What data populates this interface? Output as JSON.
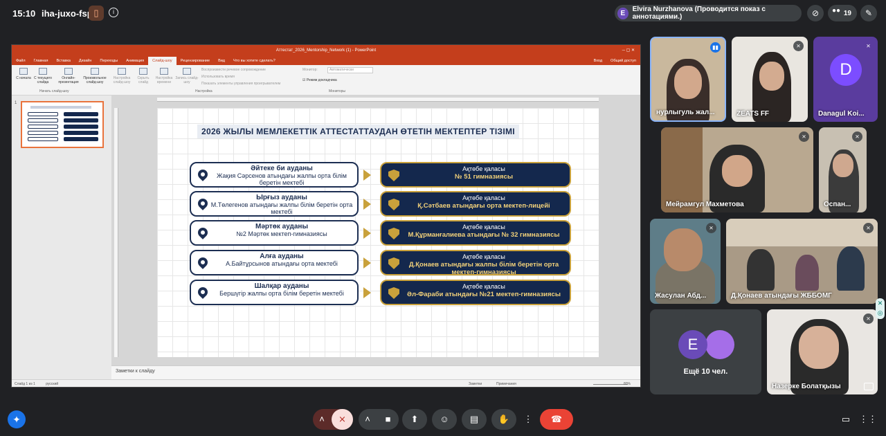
{
  "topbar": {
    "time": "15:10",
    "meeting_code": "iha-juxo-fsp",
    "presenter_initial": "E",
    "presenter_text": "Elvira Nurzhanova (Проводится показ с аннотациями.)",
    "participants_count": "19"
  },
  "ppt": {
    "window_title": "Аттестат_2026_Mentorship_Network (1) - PowerPoint",
    "tabs": [
      "Файл",
      "Главная",
      "Вставка",
      "Дизайн",
      "Переходы",
      "Анимация",
      "Слайд-шоу",
      "Рецензирование",
      "Вид",
      "Что вы хотите сделать?"
    ],
    "active_tab": "Слайд-шоу",
    "login": "Вход",
    "share": "Общий доступ",
    "ribbon": {
      "btn1": "С начала",
      "btn2": "С текущего слайда",
      "btn3": "Онлайн-презентация",
      "btn4": "Произвольное слайд-шоу",
      "group1": "Начать слайд-шоу",
      "btn5": "Настройка слайд-шоу",
      "btn6": "Скрыть слайд",
      "btn7": "Настройка времени",
      "btn8": "Запись слайд-шоу",
      "opt1": "Воспроизвести речевое сопровождение",
      "opt2": "Использовать время",
      "opt3": "Показать элементы управления проигрывателем",
      "group2": "Настройка",
      "monitor_label": "Монитор:",
      "monitor_value": "Автоматически",
      "presenter_mode": "Режим докладчика",
      "group3": "Мониторы"
    },
    "thumb_number": "1",
    "notes_placeholder": "Заметки к слайду",
    "status_left": "Слайд 1 из 1",
    "status_lang": "русский",
    "status_notes": "Заметки",
    "status_comments": "Примечания",
    "zoom": "80%"
  },
  "slide": {
    "title": "2026 ЖЫЛЫ МЕМЛЕКЕТТІК АТТЕСТАТТАУДАН ӨТЕТІН МЕКТЕПТЕР ТІЗІМІ",
    "rows": [
      {
        "district": "Әйтеке би ауданы",
        "school": "Жақия Сәрсенов атындағы жалпы орта білім беретін мектебі",
        "city": "Ақтөбе қаласы",
        "gymnasium": "№ 51 гимназиясы"
      },
      {
        "district": "Ырғыз ауданы",
        "school": "М.Төлегенов атындағы жалпы білім беретін орта мектебі",
        "city": "Ақтөбе қаласы",
        "gymnasium": "Қ.Сәтбаев атындағы орта мектеп-лицейі"
      },
      {
        "district": "Мәртөк ауданы",
        "school": "№2 Мәртөк мектеп-гимназиясы",
        "city": "Ақтөбе қаласы",
        "gymnasium": "М.Құрманғалиева атындағы № 32 гимназиясы"
      },
      {
        "district": "Алға ауданы",
        "school": "А.Байтұрсынов атындағы орта мектебі",
        "city": "Ақтөбе қаласы",
        "gymnasium": "Д.Қонаев атындағы жалпы білім беретін орта мектеп-гимназиясы"
      },
      {
        "district": "Шалқар ауданы",
        "school": "Бершүгір жалпы орта білім беретін мектебі",
        "city": "Ақтөбе қаласы",
        "gymnasium": "Әл-Фараби атындағы №21 мектеп-гимназиясы"
      }
    ]
  },
  "participants": {
    "p1": "нурлыгуль жал...",
    "p2": "ZEATS FF",
    "p3": "Danagul Koi...",
    "p3_initial": "D",
    "p4": "Мейрамгул Махметова",
    "p5": "Оспан...",
    "p6": "Жасулан Абд...",
    "p7": "Д.Қонаев атындағы ЖББОМГ",
    "more_initial": "E",
    "more_label": "Ещё 10 чел.",
    "p8": "Назерке Болатқызы"
  },
  "colors": {
    "accent_navy": "#1c2e52",
    "accent_gold": "#c9a13b",
    "ppt_red": "#c43e1c",
    "end_call": "#ea4335"
  }
}
